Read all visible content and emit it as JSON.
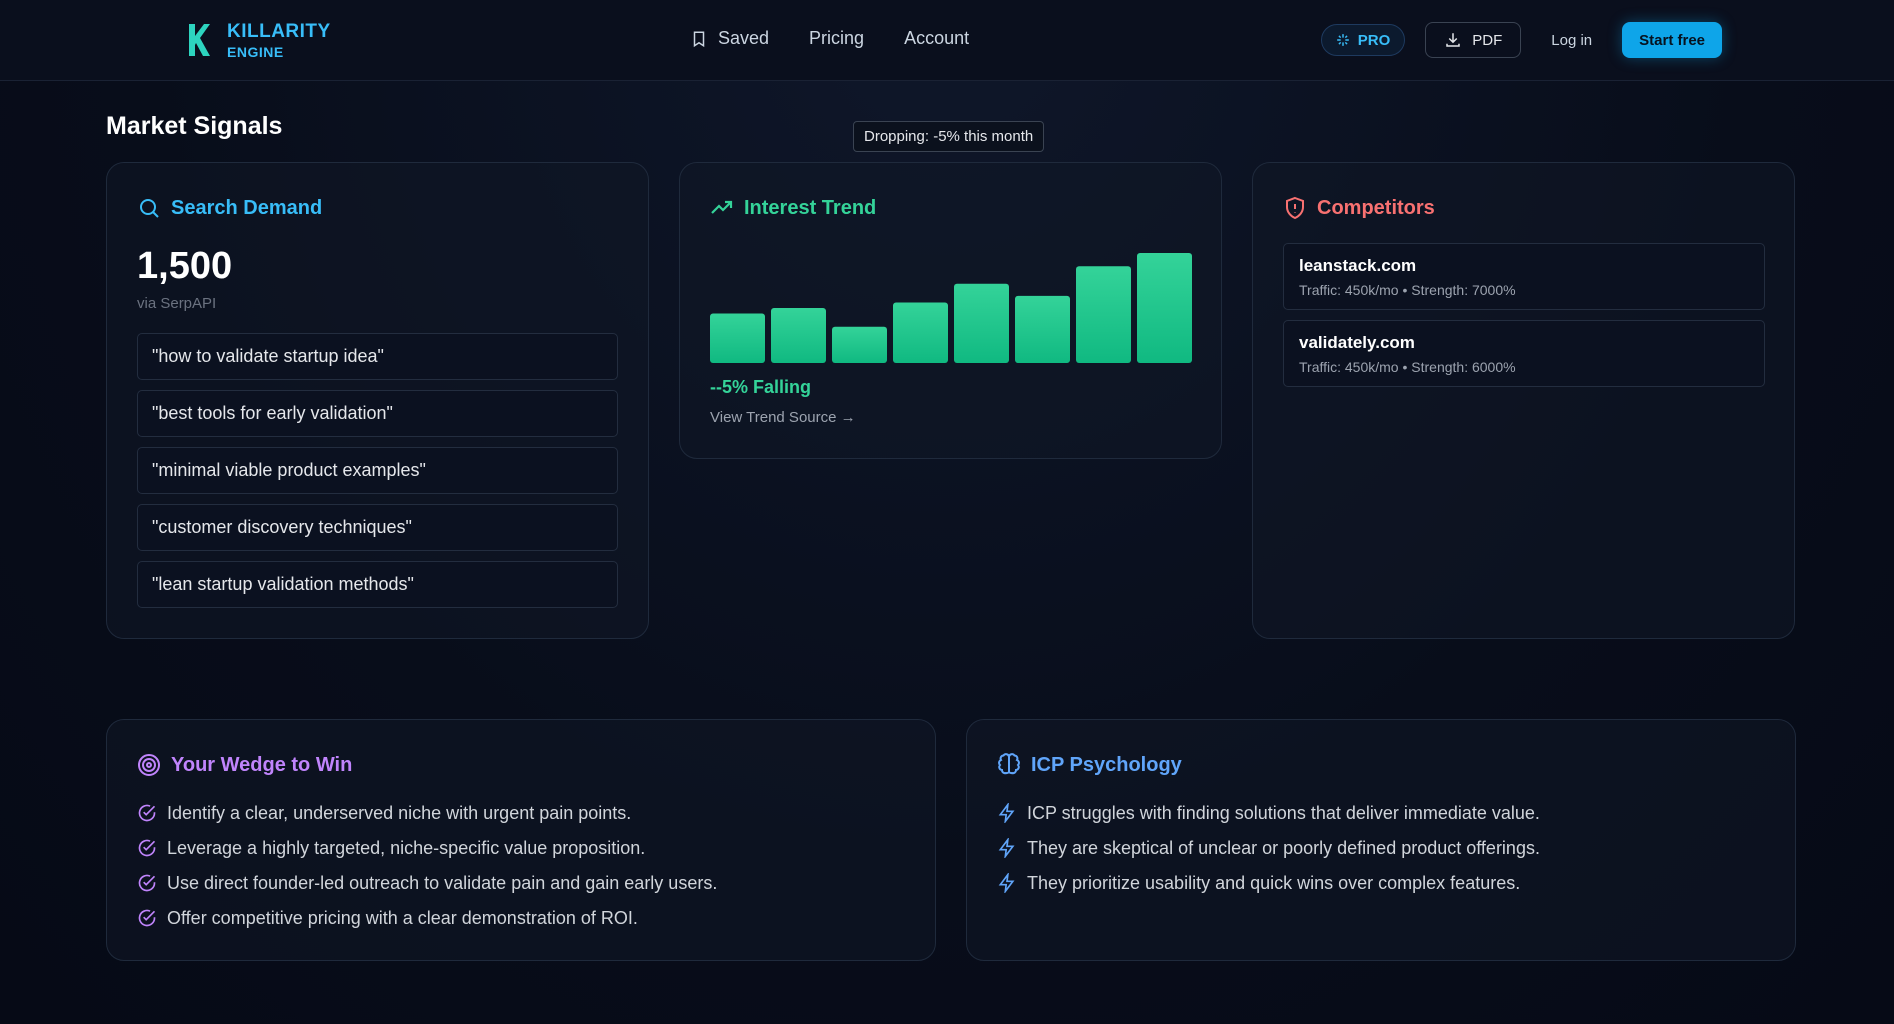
{
  "brand": {
    "name": "KILLARITY",
    "sub": "ENGINE"
  },
  "nav": {
    "saved": "Saved",
    "pricing": "Pricing",
    "account": "Account"
  },
  "actions": {
    "pro": "PRO",
    "pdf": "PDF",
    "login": "Log in",
    "start": "Start free"
  },
  "section_title": "Market Signals",
  "tooltip": "Dropping: -5% this month",
  "search": {
    "title": "Search Demand",
    "volume": "1,500",
    "source": "via SerpAPI",
    "keywords": [
      "\"how to validate startup idea\"",
      "\"best tools for early validation\"",
      "\"minimal viable product examples\"",
      "\"customer discovery techniques\"",
      "\"lean startup validation methods\""
    ]
  },
  "trend": {
    "title": "Interest Trend",
    "value": "--5% Falling",
    "link": "View Trend Source →"
  },
  "chart_data": {
    "type": "bar",
    "categories": [
      "",
      "",
      "",
      "",
      "",
      "",
      "",
      ""
    ],
    "values": [
      45,
      50,
      33,
      55,
      72,
      61,
      88,
      100
    ],
    "ylim": [
      0,
      100
    ],
    "title": "",
    "xlabel": "",
    "ylabel": ""
  },
  "competitors": {
    "title": "Competitors",
    "items": [
      {
        "name": "leanstack.com",
        "meta": "Traffic: 450k/mo • Strength: 7000%"
      },
      {
        "name": "validately.com",
        "meta": "Traffic: 450k/mo • Strength: 6000%"
      }
    ]
  },
  "wedge": {
    "title": "Your Wedge to Win",
    "items": [
      "Identify a clear, underserved niche with urgent pain points.",
      "Leverage a highly targeted, niche-specific value proposition.",
      "Use direct founder-led outreach to validate pain and gain early users.",
      "Offer competitive pricing with a clear demonstration of ROI."
    ]
  },
  "icp": {
    "title": "ICP Psychology",
    "items": [
      "ICP struggles with finding solutions that deliver immediate value.",
      "They are skeptical of unclear or poorly defined product offerings.",
      "They prioritize usability and quick wins over complex features."
    ]
  },
  "colors": {
    "accent": "#38bdf8",
    "green": "#34d399",
    "red": "#f87171",
    "purple": "#c084fc",
    "blue": "#60a5fa"
  }
}
